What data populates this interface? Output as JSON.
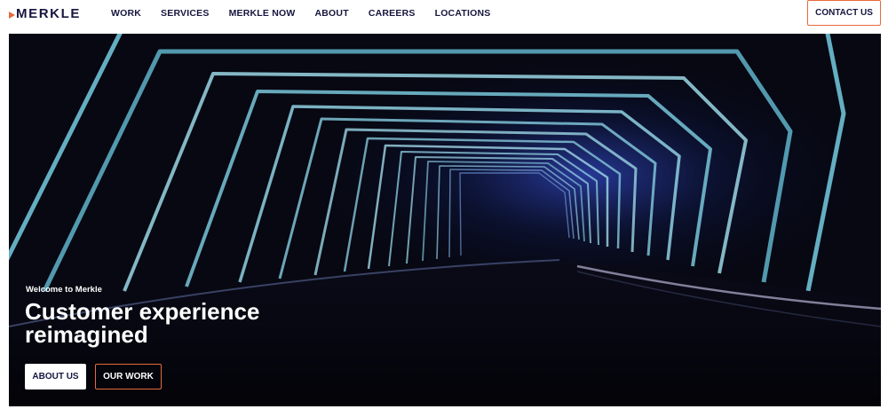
{
  "header": {
    "logo_text": "MERKLE",
    "nav": [
      "WORK",
      "SERVICES",
      "MERKLE NOW",
      "ABOUT",
      "CAREERS",
      "LOCATIONS"
    ],
    "contact_label": "CONTACT US"
  },
  "hero": {
    "eyebrow": "Welcome to Merkle",
    "title": "Customer experience reimagined",
    "buttons": {
      "about_label": "ABOUT US",
      "work_label": "OUR WORK"
    }
  },
  "colors": {
    "navy": "#16163f",
    "accent": "#e66a3c",
    "hero_bg": "#05060c"
  },
  "icons": {
    "logo_mark": "orange-triangle-icon"
  }
}
